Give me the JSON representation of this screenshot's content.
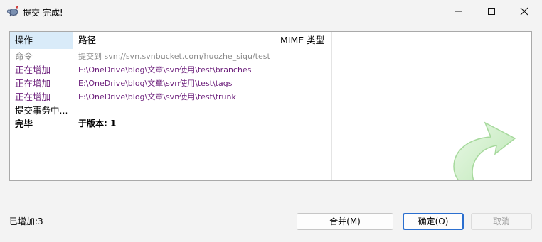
{
  "window": {
    "title": "提交 完成!",
    "minimize_glyph": "—",
    "maximize_glyph": "☐",
    "close_glyph": "✕"
  },
  "list": {
    "columns": [
      "操作",
      "路径",
      "MIME 类型"
    ],
    "rows": [
      {
        "action": "命令",
        "path": "提交到 svn://svn.svnbucket.com/huozhe_siqu/test",
        "mime": "",
        "style": "gray"
      },
      {
        "action": "正在增加",
        "path": "E:\\OneDrive\\blog\\文章\\svn使用\\test\\branches",
        "mime": "",
        "style": "purple"
      },
      {
        "action": "正在增加",
        "path": "E:\\OneDrive\\blog\\文章\\svn使用\\test\\tags",
        "mime": "",
        "style": "purple"
      },
      {
        "action": "正在增加",
        "path": "E:\\OneDrive\\blog\\文章\\svn使用\\test\\trunk",
        "mime": "",
        "style": "purple"
      },
      {
        "action": "提交事务中...",
        "path": "",
        "mime": "",
        "style": "black"
      },
      {
        "action": "完毕",
        "path": "于版本: 1",
        "mime": "",
        "style": "bold"
      }
    ]
  },
  "status": {
    "text": "已增加:3"
  },
  "buttons": {
    "merge": "合并(M)",
    "ok": "确定(O)",
    "cancel": "取消"
  },
  "colors": {
    "action_add": "#6b1d7a",
    "command": "#8a8a8a",
    "header_sorted": "#d9ebf9",
    "default_button_border": "#2b6fcf",
    "arrow": "#c9efc4"
  },
  "icons": {
    "app": "tortoise-svn-icon",
    "decoration": "green-curved-arrow-icon"
  }
}
